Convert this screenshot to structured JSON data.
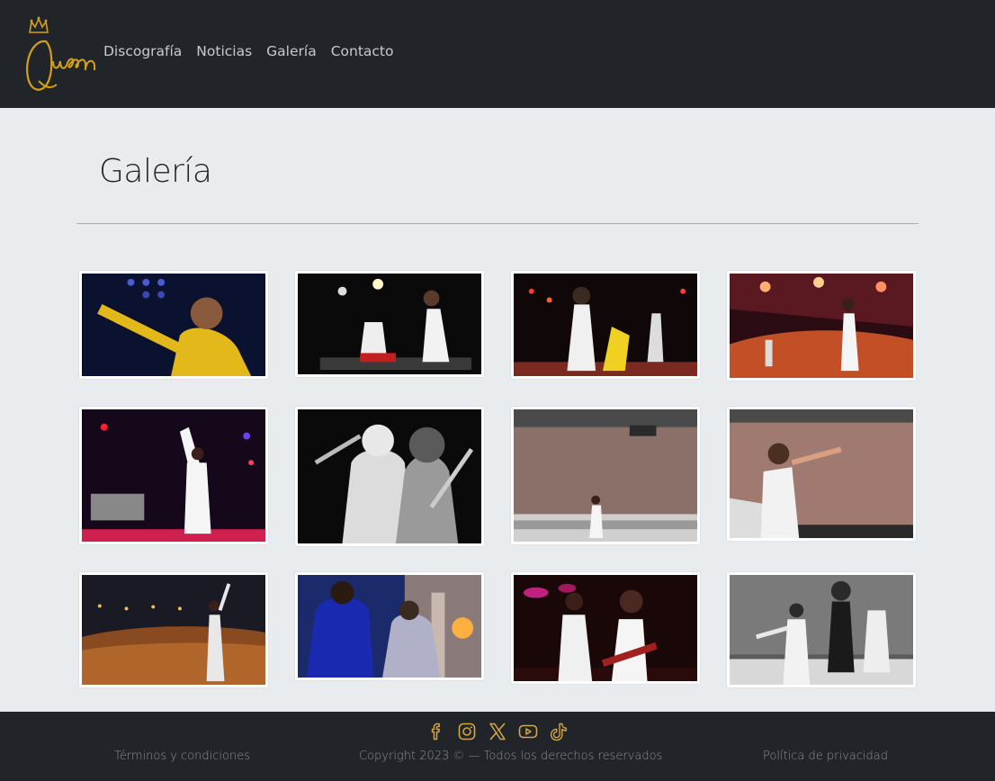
{
  "brand": {
    "logo_text": "Queen",
    "logo_color": "#d4a017"
  },
  "nav": {
    "items": [
      {
        "label": "Discografía"
      },
      {
        "label": "Noticias"
      },
      {
        "label": "Galería"
      },
      {
        "label": "Contacto"
      }
    ]
  },
  "main": {
    "title": "Galería"
  },
  "gallery": {
    "rows": 3,
    "columns": 4,
    "images": [
      {
        "style": "color"
      },
      {
        "style": "color"
      },
      {
        "style": "color"
      },
      {
        "style": "color"
      },
      {
        "style": "color"
      },
      {
        "style": "grayscale"
      },
      {
        "style": "color"
      },
      {
        "style": "color"
      },
      {
        "style": "color"
      },
      {
        "style": "color"
      },
      {
        "style": "color"
      },
      {
        "style": "grayscale"
      }
    ]
  },
  "footer": {
    "social": [
      {
        "icon": "facebook-icon"
      },
      {
        "icon": "instagram-icon"
      },
      {
        "icon": "x-icon"
      },
      {
        "icon": "youtube-icon"
      },
      {
        "icon": "tiktok-icon"
      }
    ],
    "icon_color": "#d4a54a",
    "terms": "Términos y condiciones",
    "copyright": "Copyright 2023 © — Todos los derechos reservados",
    "privacy": "Política de privacidad"
  }
}
